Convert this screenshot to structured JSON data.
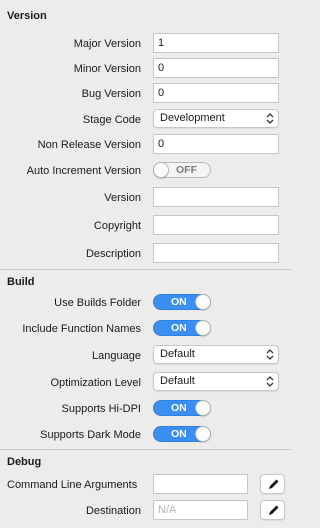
{
  "version": {
    "title": "Version",
    "major_label": "Major Version",
    "major_value": "1",
    "minor_label": "Minor Version",
    "minor_value": "0",
    "bug_label": "Bug Version",
    "bug_value": "0",
    "stage_label": "Stage Code",
    "stage_value": "Development",
    "nonrelease_label": "Non Release Version",
    "nonrelease_value": "0",
    "autoinc_label": "Auto Increment Version",
    "autoinc_state": "OFF",
    "version_label": "Version",
    "version_value": "",
    "copyright_label": "Copyright",
    "copyright_value": "",
    "description_label": "Description",
    "description_value": ""
  },
  "build": {
    "title": "Build",
    "builds_folder_label": "Use Builds Folder",
    "builds_folder_state": "ON",
    "function_names_label": "Include Function Names",
    "function_names_state": "ON",
    "language_label": "Language",
    "language_value": "Default",
    "optimization_label": "Optimization Level",
    "optimization_value": "Default",
    "hidpi_label": "Supports Hi-DPI",
    "hidpi_state": "ON",
    "darkmode_label": "Supports Dark Mode",
    "darkmode_state": "ON"
  },
  "debug": {
    "title": "Debug",
    "cmdline_label": "Command Line Arguments",
    "cmdline_value": "",
    "destination_label": "Destination",
    "destination_placeholder": "N/A"
  },
  "colors": {
    "toggle_on": "#3b8ff0",
    "background": "#ececec"
  },
  "icons": [
    "chevron-updown-icon",
    "pencil-icon"
  ]
}
